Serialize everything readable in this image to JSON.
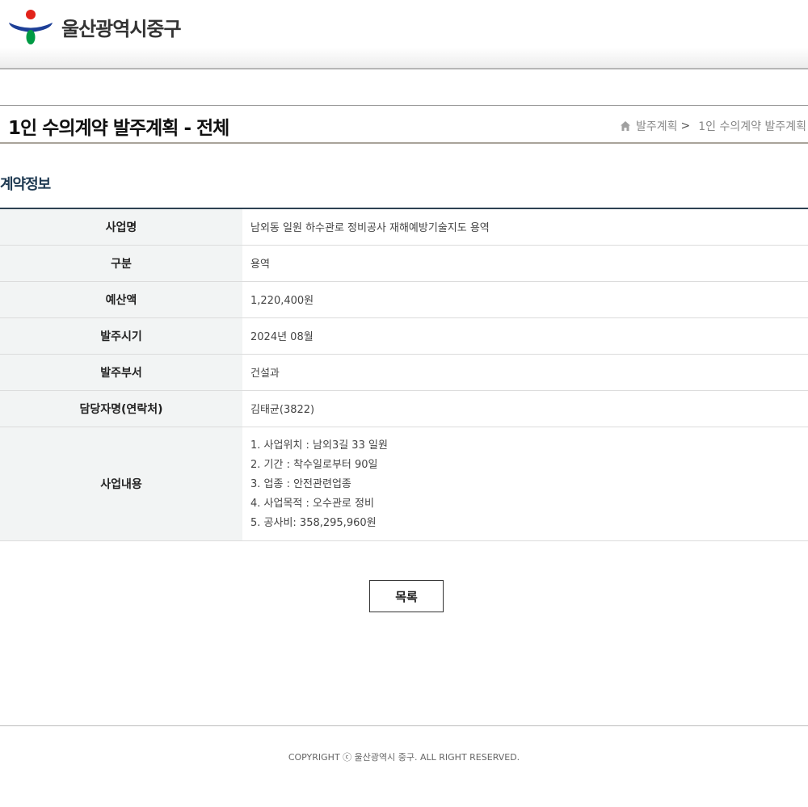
{
  "header": {
    "logo_text": "울산광역시중구",
    "logo_colors": {
      "red": "#e2231a",
      "blue": "#1d3f97",
      "green": "#009a44"
    }
  },
  "title_bar": {
    "title": "1인 수의계약 발주계획 - 전체",
    "breadcrumb": [
      "발주계획",
      "1인 수의계약 발주계획"
    ],
    "breadcrumb_separator": ">"
  },
  "section": {
    "title": "계약정보"
  },
  "contract": {
    "rows": [
      {
        "label": "사업명",
        "value": "남외동 일원 하수관로 정비공사 재해예방기술지도 용역"
      },
      {
        "label": "구분",
        "value": "용역"
      },
      {
        "label": "예산액",
        "value": "1,220,400원"
      },
      {
        "label": "발주시기",
        "value": "2024년 08월"
      },
      {
        "label": "발주부서",
        "value": "건설과"
      },
      {
        "label": "담당자명(연락처)",
        "value": "김태균(3822)"
      }
    ],
    "content_label": "사업내용",
    "content_lines": [
      "1. 사업위치 : 남외3길 33 일원",
      "2. 기간 : 착수일로부터 90일",
      "3. 업종 : 안전관련업종",
      "4. 사업목적 : 오수관로 정비",
      "5. 공사비: 358,295,960원"
    ]
  },
  "actions": {
    "list_label": "목록"
  },
  "footer": {
    "copyright": "COPYRIGHT ⓒ 울산광역시 중구. ALL RIGHT RESERVED."
  }
}
